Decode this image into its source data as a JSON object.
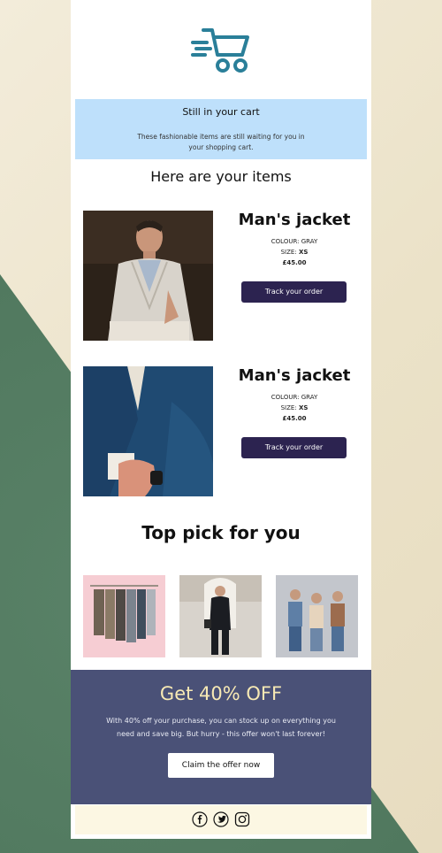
{
  "banner": {
    "title": "Still in your cart",
    "message": "These fashionable items are still waiting for you in your shopping cart."
  },
  "items_heading": "Here are your items",
  "products": [
    {
      "name": "Man's jacket",
      "colour_label": "COLOUR:",
      "colour": "GRAY",
      "size_label": "SIZE:",
      "size": "XS",
      "price": "£45.00",
      "button": "Track your order"
    },
    {
      "name": "Man's jacket",
      "colour_label": "COLOUR:",
      "colour": "GRAY",
      "size_label": "SIZE:",
      "size": "XS",
      "price": "£45.00",
      "button": "Track your order"
    }
  ],
  "top_pick": {
    "title": "Top pick for you"
  },
  "promo": {
    "headline": "Get 40% OFF",
    "body": "With 40% off your purchase, you can stock up on everything you need and save big. But hurry - this offer won't last forever!",
    "button": "Claim the offer now"
  },
  "footer": {
    "icons": [
      "facebook-icon",
      "twitter-icon",
      "instagram-icon"
    ]
  },
  "colors": {
    "brand_teal": "#2a7f99",
    "banner_bg": "#bee0fb",
    "button_bg": "#2c2350",
    "promo_bg": "#4a5177",
    "promo_headline": "#f7e9b4",
    "footer_bg": "#fcf7e3"
  }
}
